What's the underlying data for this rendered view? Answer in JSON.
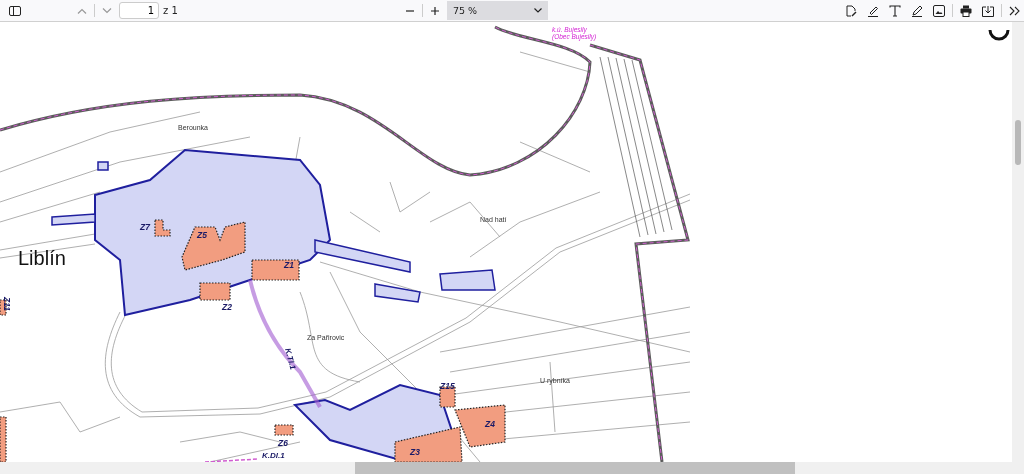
{
  "toolbar": {
    "page_number": "1",
    "page_total": "z 1",
    "zoom": "75 %"
  },
  "map": {
    "labels": [
      {
        "text": "k.ú. Bujesily",
        "kind": "cadastre"
      },
      {
        "text": "(Obec Bujesily)",
        "kind": "cadastre"
      },
      {
        "text": "Berounka",
        "kind": "place"
      },
      {
        "text": "Nad hatí",
        "kind": "place"
      },
      {
        "text": "Liblín",
        "kind": "town"
      },
      {
        "text": "Z7",
        "kind": "zone"
      },
      {
        "text": "Z5",
        "kind": "zone"
      },
      {
        "text": "Z1",
        "kind": "zone"
      },
      {
        "text": "Z2",
        "kind": "zone"
      },
      {
        "text": "Z11",
        "kind": "zone"
      },
      {
        "text": "Za Pařirovic",
        "kind": "place"
      },
      {
        "text": "K.Tl.1",
        "kind": "corridor"
      },
      {
        "text": "U rybníka",
        "kind": "place"
      },
      {
        "text": "Z15",
        "kind": "zone"
      },
      {
        "text": "Z4",
        "kind": "zone"
      },
      {
        "text": "Z6",
        "kind": "zone"
      },
      {
        "text": "K.Dl.1",
        "kind": "corridor"
      },
      {
        "text": "Z3",
        "kind": "zone"
      }
    ]
  }
}
